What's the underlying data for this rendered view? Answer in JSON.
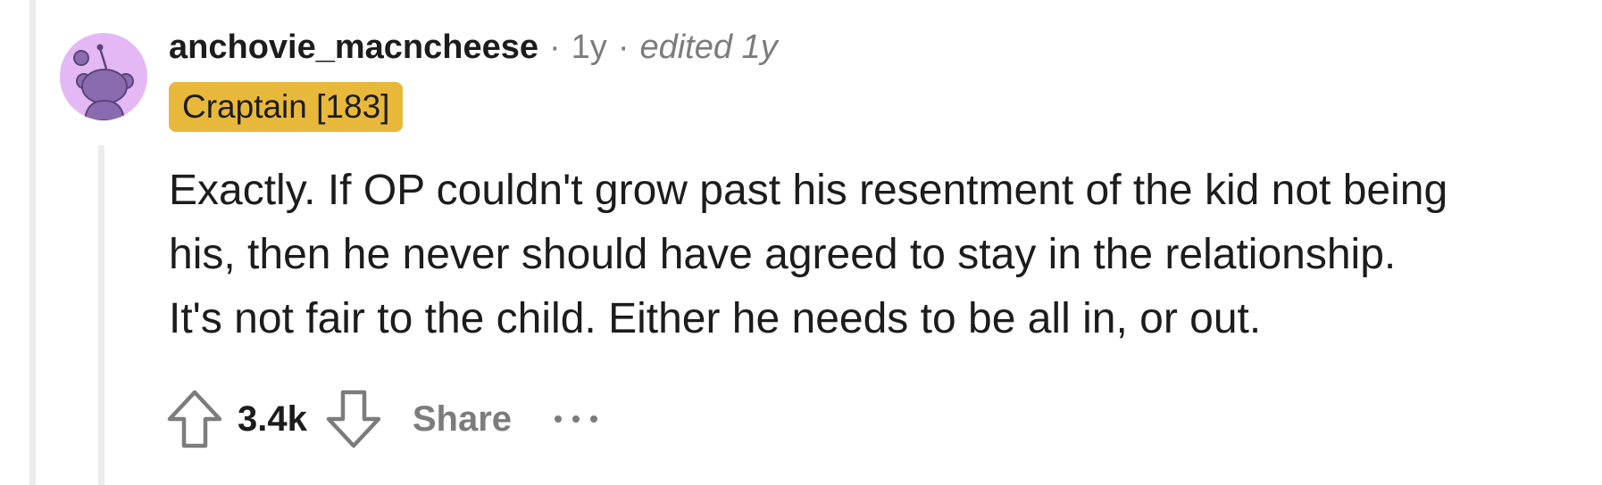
{
  "comment": {
    "username": "anchovie_macncheese",
    "separator": "·",
    "age": "1y",
    "edited": "edited 1y",
    "flair": "Craptain [183]",
    "body_lines": [
      "Exactly. If OP couldn't grow past his resentment of the kid not being",
      "his, then he never should have agreed to stay in the relationship.",
      "It's not fair to the child. Either he needs to be all in, or out."
    ],
    "score": "3.4k",
    "share_label": "Share"
  },
  "icons": {
    "avatar": "snoo-avatar-icon",
    "upvote": "upvote-arrow-icon",
    "downvote": "downvote-arrow-icon",
    "more": "more-options-icon"
  },
  "colors": {
    "avatar_bg": "#e3b8f5",
    "avatar_figure": "#8a6bb0",
    "flair_bg": "#e8b83b",
    "muted_text": "#7c7c7c",
    "thread_line": "#ececec"
  }
}
